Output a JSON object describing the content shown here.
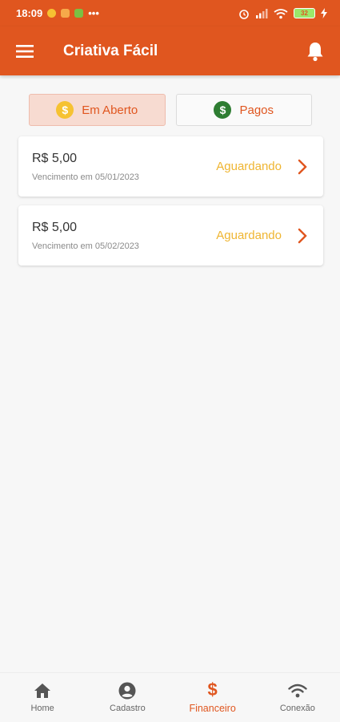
{
  "status_bar": {
    "time": "18:09",
    "dots": "•••",
    "battery": "32"
  },
  "app_bar": {
    "title": "Criativa Fácil"
  },
  "tabs": [
    {
      "label": "Em Aberto",
      "icon": "dollar-coin-icon",
      "active": true
    },
    {
      "label": "Pagos",
      "icon": "dollar-coin-icon",
      "active": false
    }
  ],
  "bills": [
    {
      "amount": "R$ 5,00",
      "due": "Vencimento em 05/01/2023",
      "status": "Aguardando"
    },
    {
      "amount": "R$ 5,00",
      "due": "Vencimento em 05/02/2023",
      "status": "Aguardando"
    }
  ],
  "bottom_nav": [
    {
      "label": "Home",
      "icon": "home-icon",
      "active": false
    },
    {
      "label": "Cadastro",
      "icon": "account-icon",
      "active": false
    },
    {
      "label": "Financeiro",
      "icon": "dollar-icon",
      "active": true
    },
    {
      "label": "Conexão",
      "icon": "wifi-icon",
      "active": false
    }
  ],
  "colors": {
    "primary": "#e0561f",
    "status_pending": "#efb531",
    "coin_gold": "#f6c232",
    "coin_green": "#2e7d32"
  }
}
